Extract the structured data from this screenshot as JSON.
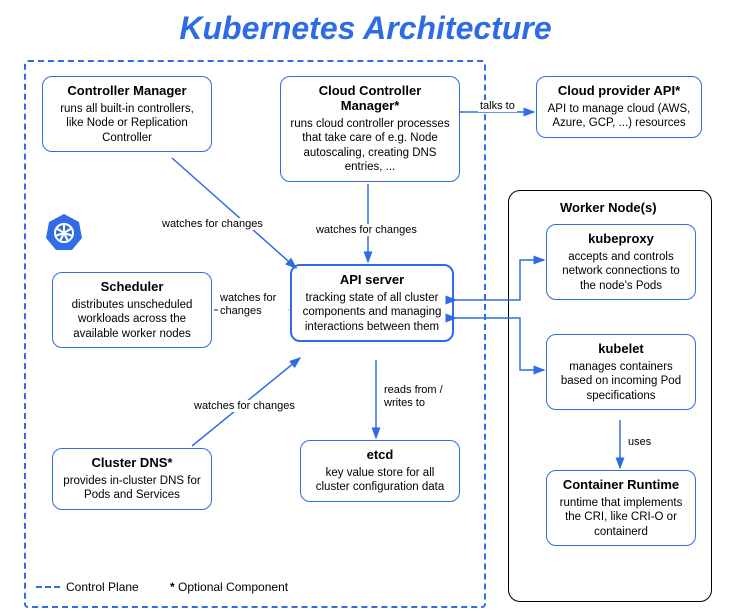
{
  "title": "Kubernetes Architecture",
  "legend": {
    "control_plane": "Control Plane",
    "optional": "Optional Component",
    "star": "*"
  },
  "worker_title": "Worker Node(s)",
  "nodes": {
    "controller_manager": {
      "title": "Controller Manager",
      "desc": "runs all built-in controllers, like Node or Replication Controller"
    },
    "cloud_controller_manager": {
      "title": "Cloud Controller Manager*",
      "desc": "runs cloud controller processes that take care of e.g. Node autoscaling, creating DNS entries, ..."
    },
    "cloud_provider_api": {
      "title": "Cloud provider API*",
      "desc": "API to manage cloud (AWS, Azure, GCP, ...) resources"
    },
    "scheduler": {
      "title": "Scheduler",
      "desc": "distributes unscheduled workloads across the available worker nodes"
    },
    "api_server": {
      "title": "API server",
      "desc": "tracking state of all cluster components and managing interactions between them"
    },
    "cluster_dns": {
      "title": "Cluster DNS*",
      "desc": "provides in-cluster DNS for Pods and Services"
    },
    "etcd": {
      "title": "etcd",
      "desc": "key value store for all cluster configuration data"
    },
    "kubeproxy": {
      "title": "kubeproxy",
      "desc": "accepts and controls network connections to the node's Pods"
    },
    "kubelet": {
      "title": "kubelet",
      "desc": "manages containers based on incoming Pod specifications"
    },
    "container_runtime": {
      "title": "Container Runtime",
      "desc": "runtime that implements the CRI, like CRI-O or containerd"
    }
  },
  "edges": {
    "talks_to": "talks to",
    "watches_ccm": "watches for changes",
    "watches_cm": "watches for changes",
    "watches_scheduler": "watches for changes",
    "watches_dns": "watches for changes",
    "reads_writes": "reads from / writes to",
    "uses": "uses"
  },
  "icon": "kubernetes-logo"
}
